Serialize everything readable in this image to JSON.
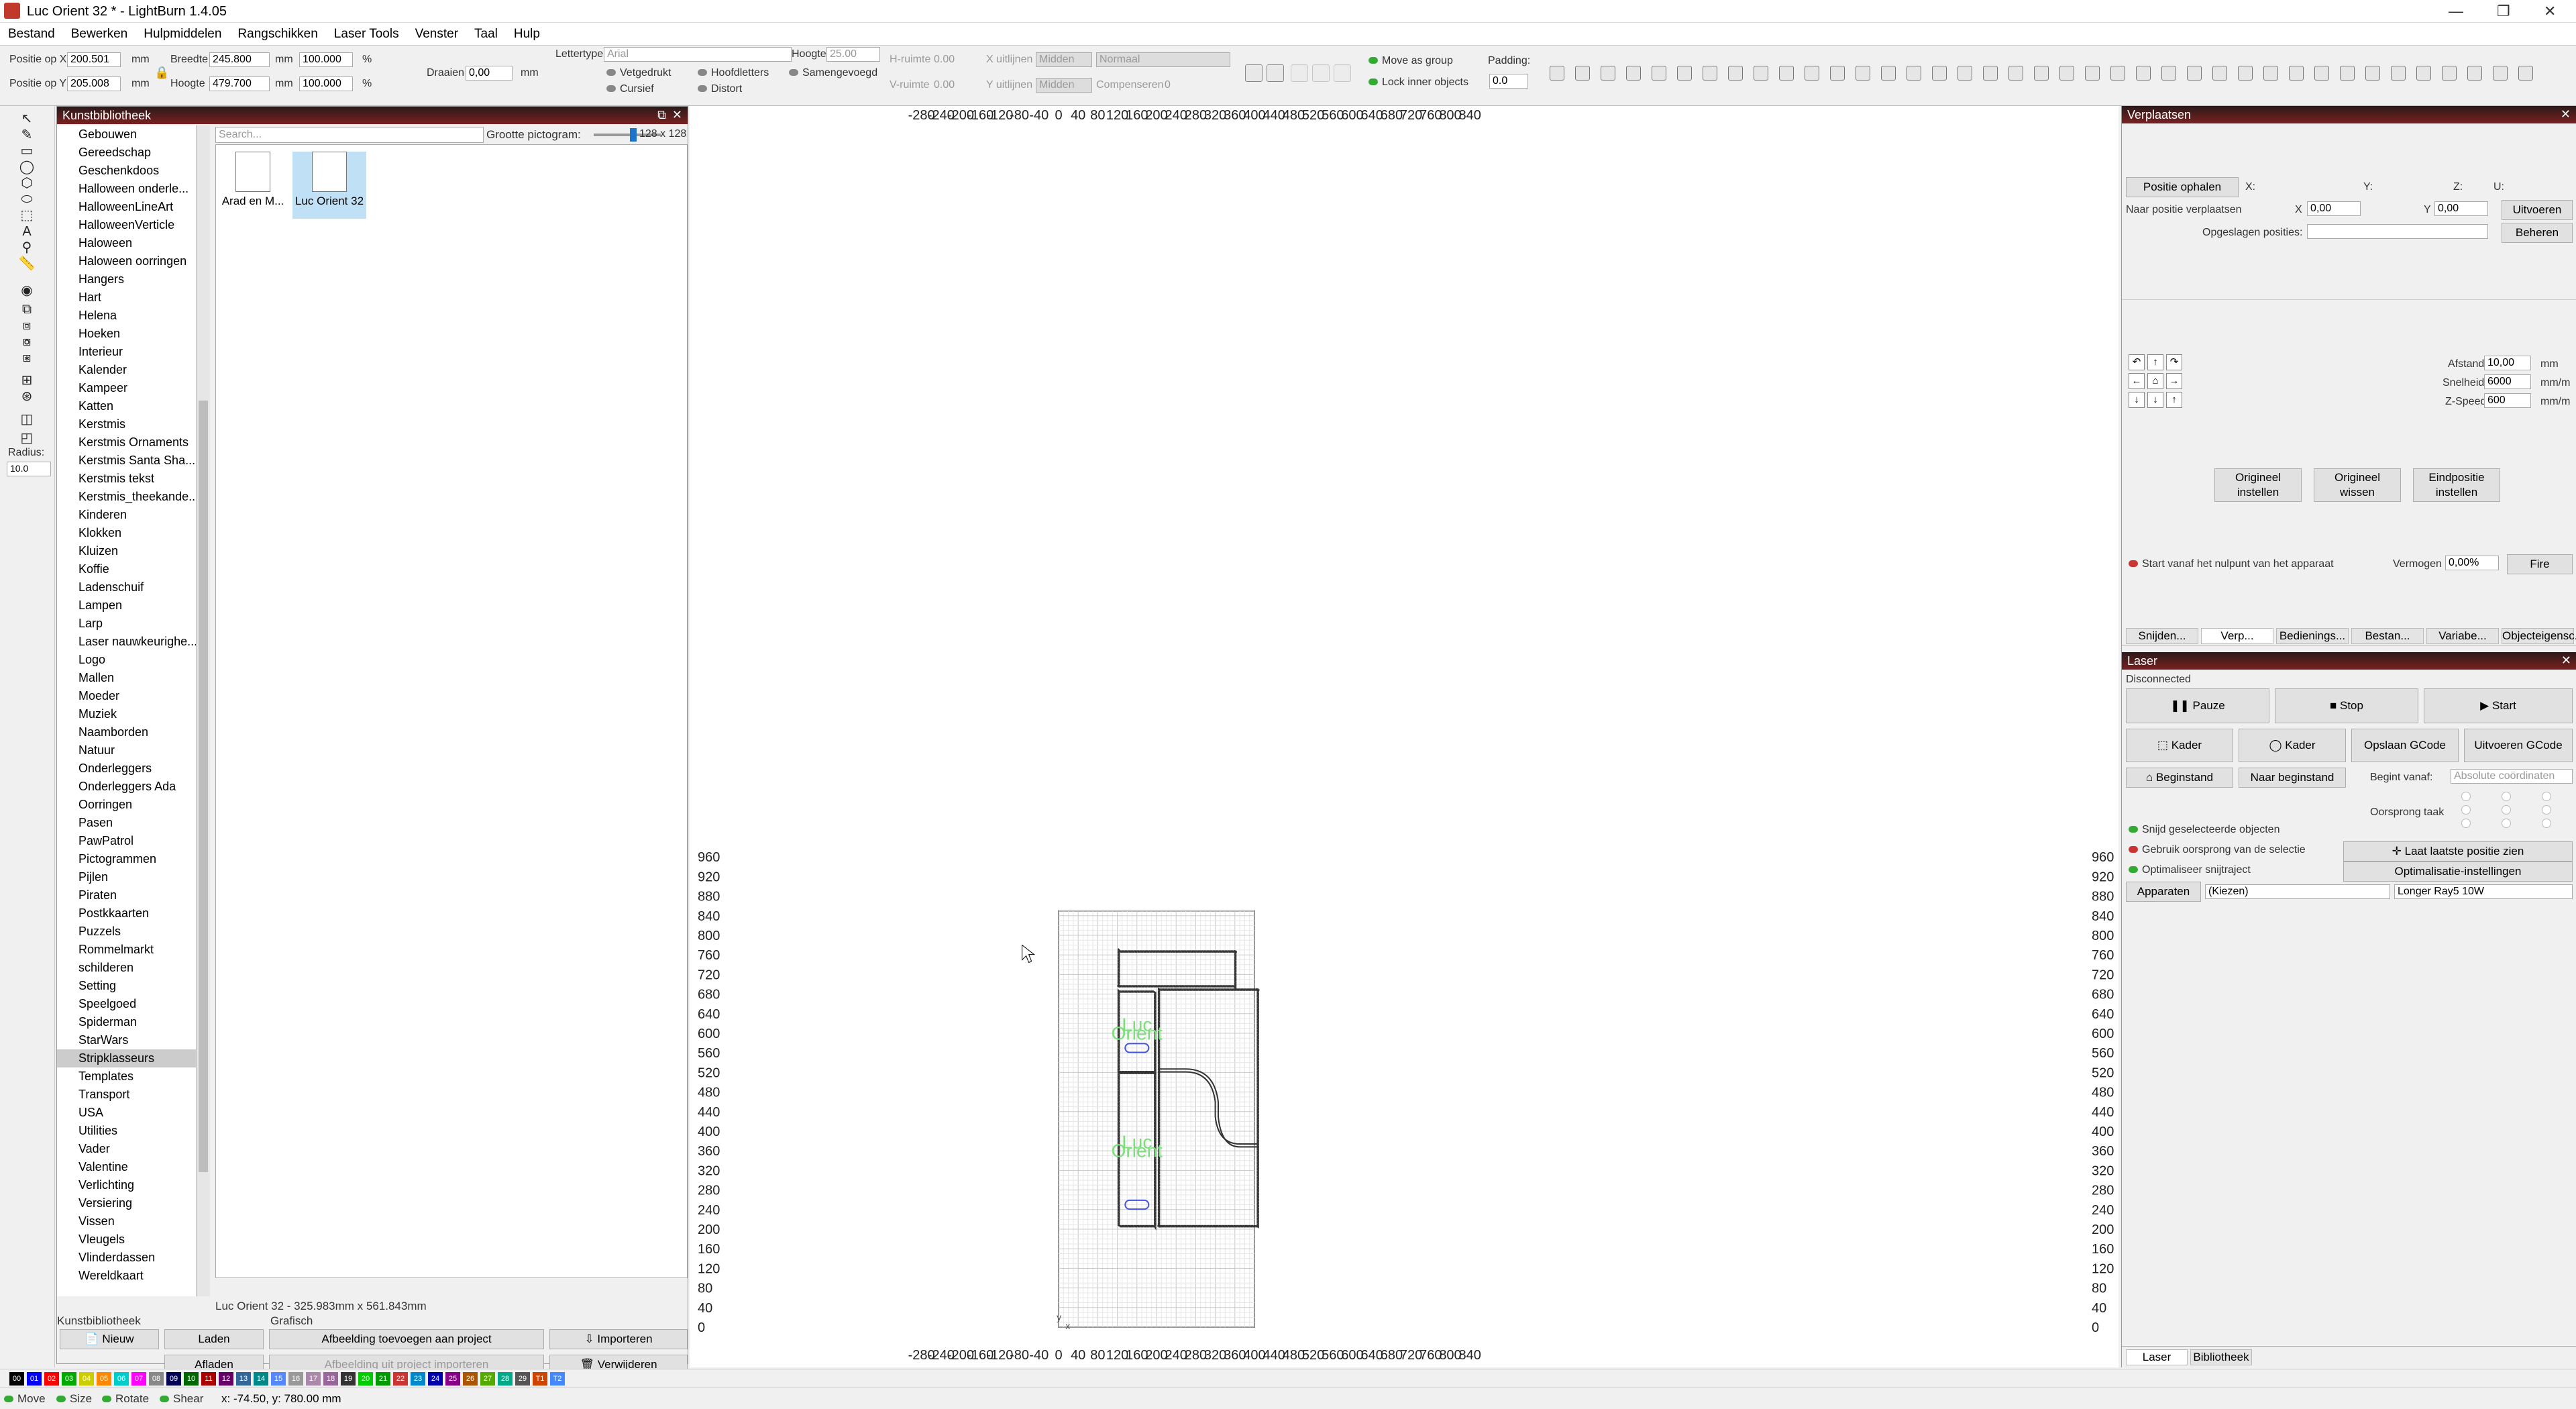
{
  "window": {
    "title": "Luc Orient 32 * - LightBurn 1.4.05",
    "minimize": "—",
    "maximize": "❐",
    "close": "✕"
  },
  "menu": [
    "Bestand",
    "Bewerken",
    "Hulpmiddelen",
    "Rangschikken",
    "Laser Tools",
    "Venster",
    "Taal",
    "Hulp"
  ],
  "toolbar": {
    "posx_label": "Positie op X",
    "posx": "200.501",
    "posy_label": "Positie op Y",
    "posy": "205.008",
    "unit": "mm",
    "width_label": "Breedte",
    "width": "245.800",
    "height_label": "Hoogte",
    "height": "479.700",
    "scale_w": "100.000",
    "scale_h": "100.000",
    "pct": "%",
    "rotate_label": "Draaien",
    "rotate": "0,00",
    "rotate_unit": "mm",
    "font_label": "Lettertype",
    "font": "Arial",
    "height2_label": "Hoogte",
    "height2": "25.00",
    "hspace_label": "H-ruimte",
    "hspace": "0.00",
    "vspace_label": "V-ruimte",
    "vspace": "0.00",
    "xalign_label": "X uitlijnen",
    "xalign": "Midden",
    "yalign_label": "Y uitlijnen",
    "yalign": "Midden",
    "normal": "Normaal",
    "comp_label": "Compenseren",
    "comp": "0",
    "bold": "Vetgedrukt",
    "italic": "Cursief",
    "caps": "Hoofdletters",
    "distort": "Distort",
    "welded": "Samengevoegd",
    "move_group": "Move as group",
    "lock_inner": "Lock inner objects",
    "padding_label": "Padding:",
    "padding": "0.0"
  },
  "left_tools": {
    "radius_label": "Radius:",
    "radius": "10.0"
  },
  "library": {
    "title": "Kunstbibliotheek",
    "close": "✕",
    "float": "⧉",
    "search_placeholder": "Search...",
    "icon_size_label": "Grootte pictogram:",
    "icon_size": "128 x 128",
    "categories": [
      "Gebouwen",
      "Gereedschap",
      "Geschenkdoos",
      "Halloween onderle...",
      "HalloweenLineArt",
      "HalloweenVerticle",
      "Haloween",
      "Haloween oorringen",
      "Hangers",
      "Hart",
      "Helena",
      "Hoeken",
      "Interieur",
      "Kalender",
      "Kampeer",
      "Katten",
      "Kerstmis",
      "Kerstmis Ornaments",
      "Kerstmis Santa Sha...",
      "Kerstmis tekst",
      "Kerstmis_theekande...",
      "Kinderen",
      "Klokken",
      "Kluizen",
      "Koffie",
      "Ladenschuif",
      "Lampen",
      "Larp",
      "Laser nauwkeurighe...",
      "Logo",
      "Mallen",
      "Moeder",
      "Muziek",
      "Naamborden",
      "Natuur",
      "Onderleggers",
      "Onderleggers Ada",
      "Oorringen",
      "Pasen",
      "PawPatrol",
      "Pictogrammen",
      "Pijlen",
      "Piraten",
      "Postkkaarten",
      "Puzzels",
      "Rommelmarkt",
      "schilderen",
      "Setting",
      "Speelgoed",
      "Spiderman",
      "StarWars",
      "Stripklasseurs",
      "Templates",
      "Transport",
      "USA",
      "Utilities",
      "Vader",
      "Valentine",
      "Verlichting",
      "Versiering",
      "Vissen",
      "Vleugels",
      "Vlinderdassen",
      "Wereldkaart"
    ],
    "selected_category": "Stripklasseurs",
    "items": [
      "Arad en M...",
      "Luc Orient 32"
    ],
    "info": "Luc Orient 32 - 325.983mm x 561.843mm",
    "group": "Grafisch",
    "tab": "Kunstbibliotheek",
    "btn_new": "Nieuw",
    "btn_load": "Laden",
    "btn_add": "Afbeelding toevoegen aan project",
    "btn_import": "Importeren",
    "btn_unload": "Afladen",
    "btn_import_proj": "Afbeelding uit project importeren",
    "btn_delete": "Verwijderen"
  },
  "canvas": {
    "x_ticks": [
      "-280",
      "-240",
      "-200",
      "-160",
      "-120",
      "-80",
      "-40",
      "0",
      "40",
      "80",
      "120",
      "160",
      "200",
      "240",
      "280",
      "320",
      "360",
      "400",
      "440",
      "480",
      "520",
      "560",
      "600",
      "640",
      "680",
      "720",
      "760",
      "800",
      "840"
    ],
    "y_ticks": [
      "960",
      "920",
      "880",
      "840",
      "800",
      "760",
      "720",
      "680",
      "640",
      "600",
      "560",
      "520",
      "480",
      "440",
      "400",
      "360",
      "320",
      "280",
      "240",
      "200",
      "160",
      "120",
      "80",
      "40",
      "0"
    ],
    "text1_line1": "Luc",
    "text1_line2": "Orient",
    "text2_line1": "Luc",
    "text2_line2": "Orient",
    "origin_x": "x",
    "origin_y": "y",
    "text_color": "#7be07b",
    "slot_color": "#4455dd"
  },
  "move_panel": {
    "title": "Verplaatsen",
    "get_pos": "Positie ophalen",
    "x": "X:",
    "y": "Y:",
    "z": "Z:",
    "u": "U:",
    "goto_label": "Naar positie verplaatsen",
    "gx": "X",
    "gx_val": "0,00",
    "gy": "Y",
    "gy_val": "0,00",
    "execute": "Uitvoeren",
    "saved_label": "Opgeslagen posities:",
    "manage": "Beheren",
    "dist_label": "Afstand",
    "dist": "10,00",
    "dist_unit": "mm",
    "speed_label": "Snelheid",
    "speed": "6000",
    "speed_unit": "mm/m",
    "zspeed_label": "Z-Speed",
    "zspeed": "600",
    "zspeed_unit": "mm/m",
    "set_origin_l1": "Origineel",
    "set_origin_l2": "instellen",
    "clear_origin_l1": "Origineel",
    "clear_origin_l2": "wissen",
    "set_end_l1": "Eindpositie",
    "set_end_l2": "instellen",
    "start_zero": "Start vanaf het nulpunt van het apparaat",
    "power_label": "Vermogen",
    "power": "0,00%",
    "fire": "Fire",
    "tabs": [
      "Snijden...",
      "Verp...",
      "Bedienings...",
      "Bestan...",
      "Variabe...",
      "Objecteigensc..."
    ]
  },
  "laser_panel": {
    "title": "Laser",
    "status": "Disconnected",
    "pause": "Pauze",
    "stop": "Stop",
    "start": "Start",
    "frame1": "Kader",
    "frame2": "Kader",
    "save_gcode": "Opslaan GCode",
    "run_gcode": "Uitvoeren GCode",
    "home": "Beginstand",
    "goto_home": "Naar beginstand",
    "start_from_label": "Begint vanaf:",
    "start_from": "Absolute coördinaten",
    "job_origin": "Oorsprong taak",
    "cut_selected": "Snijd geselecteerde objecten",
    "use_sel_origin": "Gebruik oorsprong van de selectie",
    "optimize": "Optimaliseer snijtraject",
    "show_last": "Laat laatste positie zien",
    "opt_settings": "Optimalisatie-instellingen",
    "devices": "Apparaten",
    "choose": "(Kiezen)",
    "device": "Longer Ray5 10W",
    "bottom_tabs": [
      "Laser",
      "Bibliotheek"
    ]
  },
  "colors": [
    "00",
    "01",
    "02",
    "03",
    "04",
    "05",
    "06",
    "07",
    "08",
    "09",
    "10",
    "11",
    "12",
    "13",
    "14",
    "15",
    "16",
    "17",
    "18",
    "19",
    "20",
    "21",
    "22",
    "23",
    "24",
    "25",
    "26",
    "27",
    "28",
    "29",
    "T1",
    "T2"
  ],
  "status": {
    "move": "Move",
    "size": "Size",
    "rotate": "Rotate",
    "shear": "Shear",
    "coords": "x: -74.50, y: 780.00 mm"
  }
}
